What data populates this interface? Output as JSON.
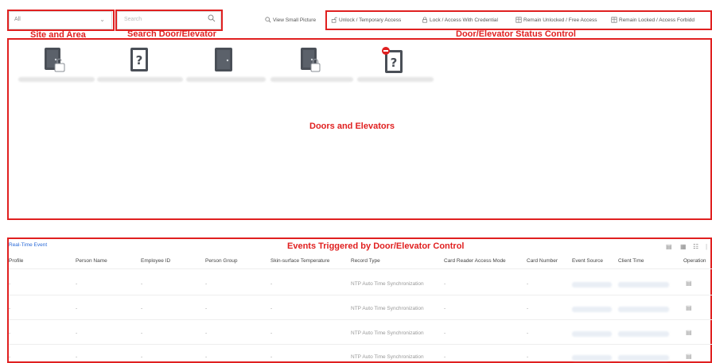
{
  "topbar": {
    "site_select_value": "All",
    "search_placeholder": "Search",
    "view_small_picture": "View Small Picture",
    "actions": [
      {
        "label": "Unlock / Temporary Access"
      },
      {
        "label": "Lock / Access With Credential"
      },
      {
        "label": "Remain Unlocked / Free Access"
      },
      {
        "label": "Remain Locked / Access Forbidd"
      }
    ]
  },
  "annotations": {
    "site_and_area": "Site and Area",
    "search_door": "Search Door/Elevator",
    "status_control": "Door/Elevator Status Control",
    "doors_and_elevators": "Doors and Elevators",
    "events_triggered": "Events Triggered by Door/Elevator Control"
  },
  "doors": [
    {
      "icon": "door-unlocked-icon"
    },
    {
      "icon": "door-unknown-icon"
    },
    {
      "icon": "door-closed-icon"
    },
    {
      "icon": "door-locked-icon"
    },
    {
      "icon": "door-offline-icon"
    }
  ],
  "events": {
    "title": "Real-Time Event",
    "columns": [
      "Profile",
      "Person Name",
      "Employee ID",
      "Person Group",
      "Skin-surface Temperature",
      "Record Type",
      "Card Reader Access Mode",
      "Card Number",
      "Event Source",
      "Client Time",
      "Operation"
    ],
    "rows": [
      {
        "profile": "-",
        "person_name": "-",
        "employee_id": "-",
        "person_group": "-",
        "temperature": "-",
        "record_type": "NTP Auto Time Synchronization",
        "access_mode": "-",
        "card_number": "-"
      },
      {
        "profile": "-",
        "person_name": "-",
        "employee_id": "-",
        "person_group": "-",
        "temperature": "-",
        "record_type": "NTP Auto Time Synchronization",
        "access_mode": "-",
        "card_number": "-"
      },
      {
        "profile": "-",
        "person_name": "-",
        "employee_id": "-",
        "person_group": "-",
        "temperature": "-",
        "record_type": "NTP Auto Time Synchronization",
        "access_mode": "-",
        "card_number": "-"
      },
      {
        "profile": "-",
        "person_name": "-",
        "employee_id": "-",
        "person_group": "-",
        "temperature": "-",
        "record_type": "NTP Auto Time Synchronization",
        "access_mode": "-",
        "card_number": "-"
      }
    ]
  },
  "colors": {
    "annotation_red": "#e02020",
    "door_icon_dark": "#4a4f57",
    "link_blue": "#2a6bd8"
  }
}
